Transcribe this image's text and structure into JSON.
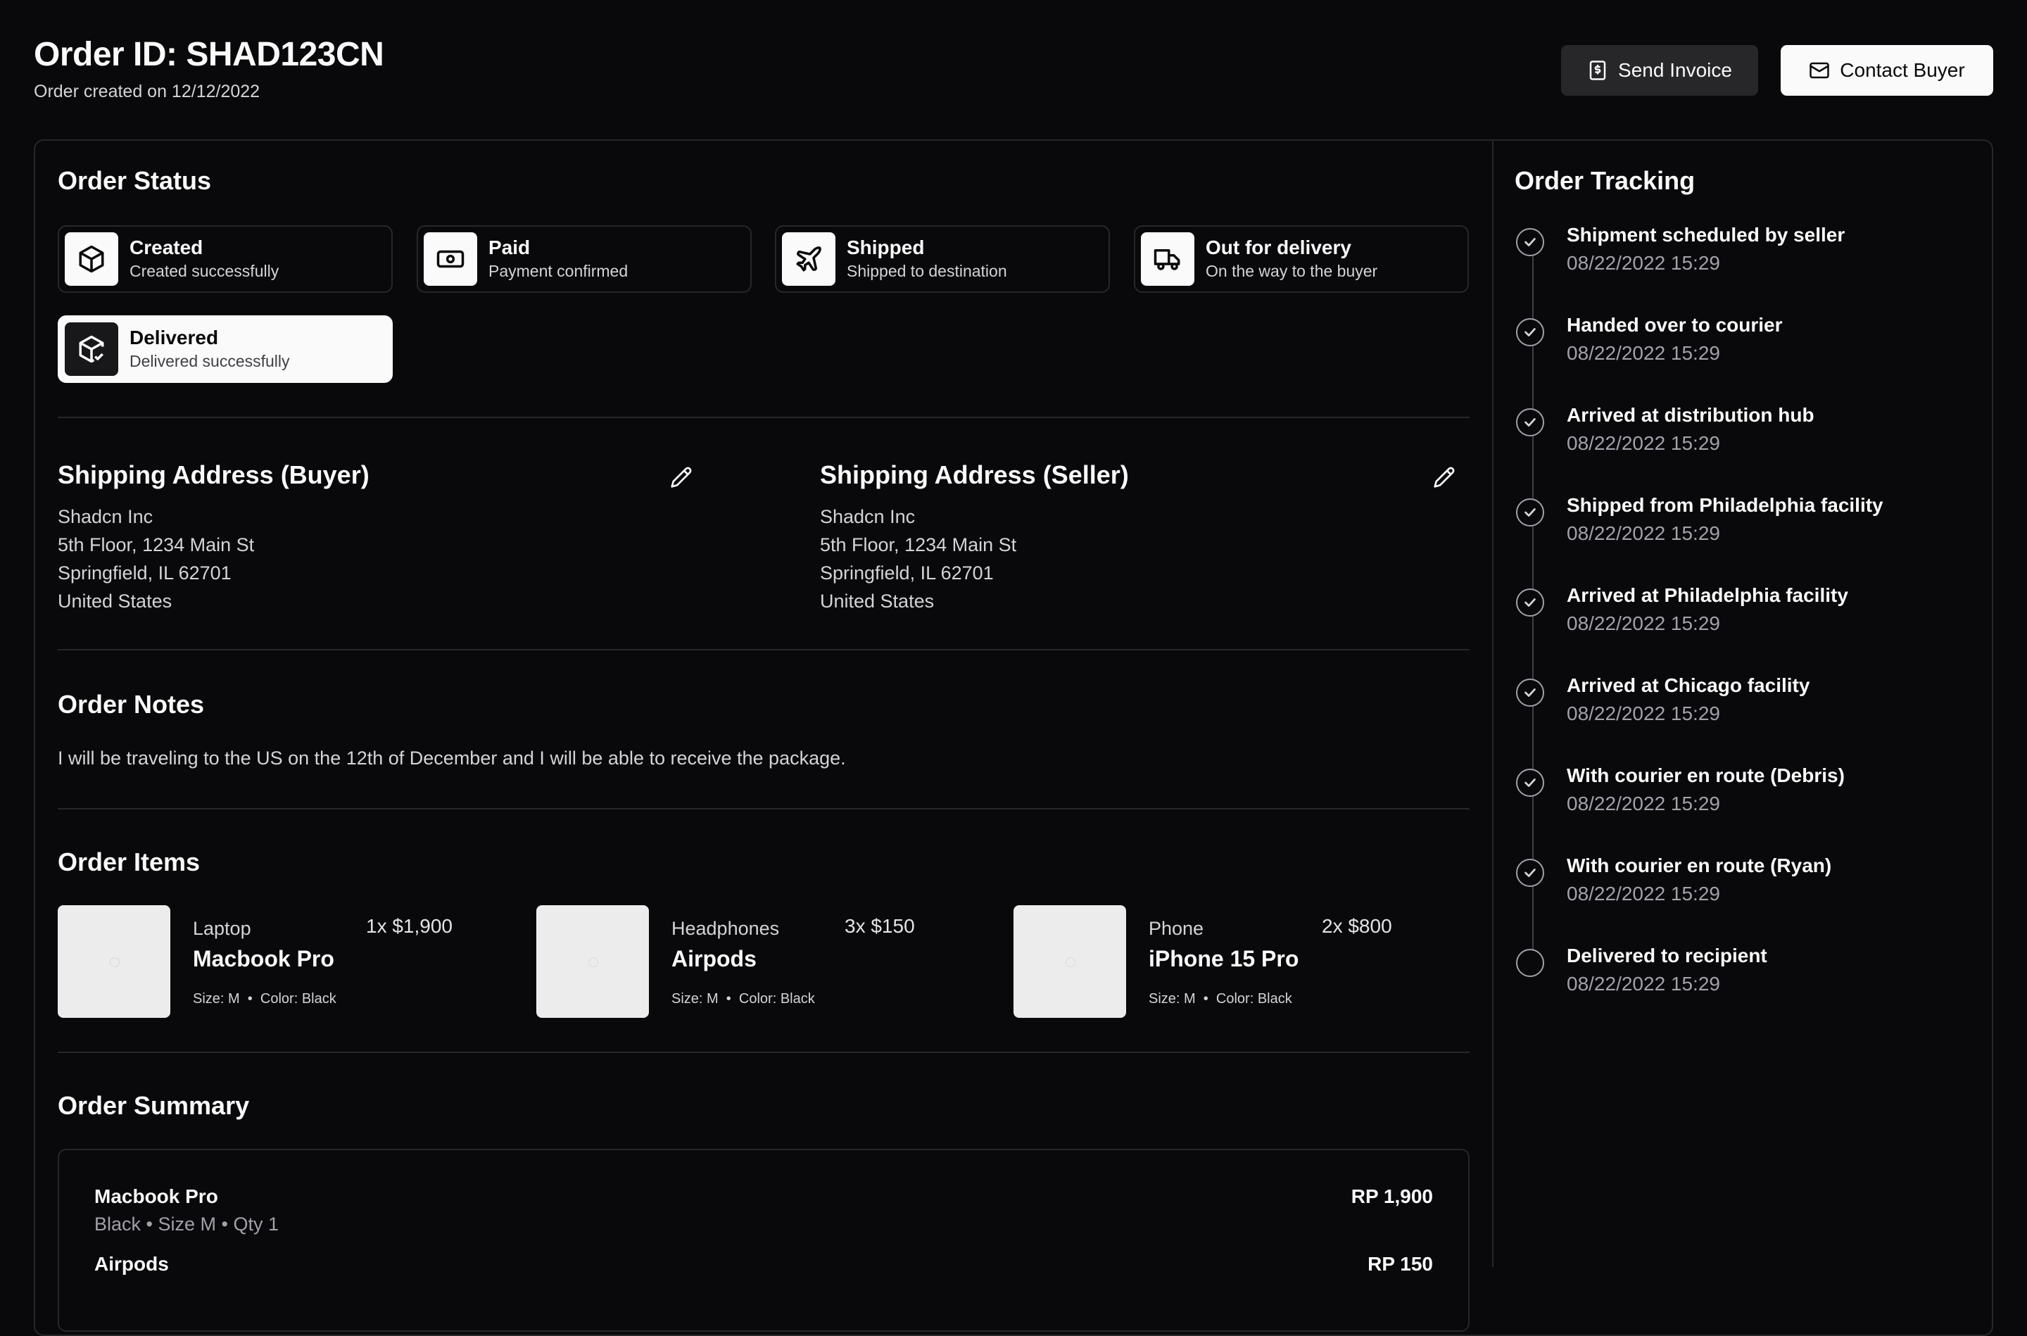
{
  "header": {
    "title": "Order ID: SHAD123CN",
    "subtitle": "Order created on 12/12/2022",
    "send_invoice_label": "Send Invoice",
    "contact_buyer_label": "Contact Buyer"
  },
  "order_status": {
    "title": "Order Status",
    "steps": [
      {
        "label": "Created",
        "desc": "Created successfully",
        "icon": "package-icon"
      },
      {
        "label": "Paid",
        "desc": "Payment confirmed",
        "icon": "banknote-icon"
      },
      {
        "label": "Shipped",
        "desc": "Shipped to destination",
        "icon": "plane-icon"
      },
      {
        "label": "Out for delivery",
        "desc": "On the way to the buyer",
        "icon": "truck-icon"
      },
      {
        "label": "Delivered",
        "desc": "Delivered successfully",
        "icon": "package-check-icon",
        "active": true
      }
    ]
  },
  "shipping": {
    "buyer": {
      "title": "Shipping Address (Buyer)",
      "line1": "Shadcn Inc",
      "line2": "5th Floor, 1234 Main St",
      "line3": "Springfield, IL 62701",
      "line4": "United States"
    },
    "seller": {
      "title": "Shipping Address (Seller)",
      "line1": "Shadcn Inc",
      "line2": "5th Floor, 1234 Main St",
      "line3": "Springfield, IL 62701",
      "line4": "United States"
    }
  },
  "notes": {
    "title": "Order Notes",
    "text": "I will be traveling to the US on the 12th of December and I will be able to receive the package."
  },
  "items": {
    "title": "Order Items",
    "list": [
      {
        "category": "Laptop",
        "name": "Macbook Pro",
        "qty": "1x $1,900",
        "size": "Size: M",
        "color": "Color: Black"
      },
      {
        "category": "Headphones",
        "name": "Airpods",
        "qty": "3x $150",
        "size": "Size: M",
        "color": "Color: Black"
      },
      {
        "category": "Phone",
        "name": "iPhone 15 Pro",
        "qty": "2x $800",
        "size": "Size: M",
        "color": "Color: Black"
      }
    ]
  },
  "summary": {
    "title": "Order Summary",
    "rows": [
      {
        "name": "Macbook Pro",
        "meta": "Black • Size M • Qty 1",
        "price": "RP 1,900"
      },
      {
        "name": "Airpods",
        "meta": "",
        "price": "RP 150"
      }
    ]
  },
  "tracking": {
    "title": "Order Tracking",
    "events": [
      {
        "title": "Shipment scheduled by seller",
        "time": "08/22/2022 15:29",
        "done": true
      },
      {
        "title": "Handed over to courier",
        "time": "08/22/2022 15:29",
        "done": true
      },
      {
        "title": "Arrived at distribution hub",
        "time": "08/22/2022 15:29",
        "done": true
      },
      {
        "title": "Shipped from Philadelphia facility",
        "time": "08/22/2022 15:29",
        "done": true
      },
      {
        "title": "Arrived at Philadelphia facility",
        "time": "08/22/2022 15:29",
        "done": true
      },
      {
        "title": "Arrived at Chicago facility",
        "time": "08/22/2022 15:29",
        "done": true
      },
      {
        "title": "With courier en route (Debris)",
        "time": "08/22/2022 15:29",
        "done": true
      },
      {
        "title": "With courier en route (Ryan)",
        "time": "08/22/2022 15:29",
        "done": true
      },
      {
        "title": "Delivered to recipient",
        "time": "08/22/2022 15:29",
        "done": false
      }
    ]
  }
}
